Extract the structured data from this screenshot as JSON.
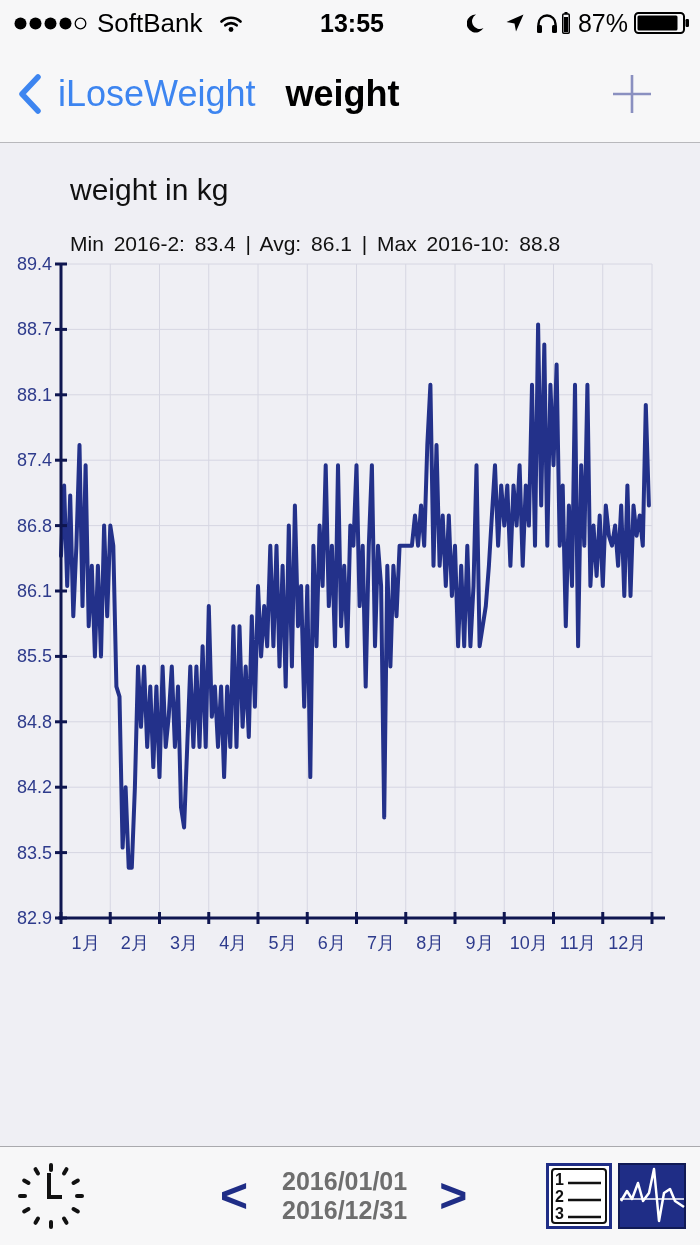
{
  "status_bar": {
    "carrier": "SoftBank",
    "time": "13:55",
    "battery": "87%"
  },
  "nav_bar": {
    "back_label": "iLoseWeight",
    "title": "weight"
  },
  "chart": {
    "summary": "Min 2016-2: 83.4 | Avg: 86.1 | Max 2016-10: 88.8",
    "chart_data": {
      "type": "line",
      "title": "weight in kg",
      "x": [
        0,
        0.0625,
        0.125,
        0.1875,
        0.25,
        0.3125,
        0.375,
        0.4375,
        0.5,
        0.5625,
        0.625,
        0.6875,
        0.75,
        0.8125,
        0.875,
        0.9375,
        1,
        1.0625,
        1.125,
        1.1875,
        1.25,
        1.3125,
        1.375,
        1.4375,
        1.5,
        1.5625,
        1.625,
        1.6875,
        1.75,
        1.8125,
        1.875,
        1.9375,
        2,
        2.0625,
        2.125,
        2.1875,
        2.25,
        2.3125,
        2.375,
        2.4375,
        2.5,
        2.5625,
        2.625,
        2.6875,
        2.75,
        2.8125,
        2.875,
        2.9375,
        3,
        3.0625,
        3.125,
        3.1875,
        3.25,
        3.3125,
        3.375,
        3.4375,
        3.5,
        3.5625,
        3.625,
        3.6875,
        3.75,
        3.8125,
        3.875,
        3.9375,
        4,
        4.0625,
        4.125,
        4.1875,
        4.25,
        4.3125,
        4.375,
        4.4375,
        4.5,
        4.5625,
        4.625,
        4.6875,
        4.75,
        4.8125,
        4.875,
        4.9375,
        5,
        5.0625,
        5.125,
        5.1875,
        5.25,
        5.3125,
        5.375,
        5.4375,
        5.5,
        5.5625,
        5.625,
        5.6875,
        5.75,
        5.8125,
        5.875,
        5.9375,
        6,
        6.0625,
        6.125,
        6.1875,
        6.25,
        6.3125,
        6.375,
        6.4375,
        6.5,
        6.5625,
        6.625,
        6.6875,
        6.75,
        6.8125,
        6.875,
        6.9375,
        7,
        7.0625,
        7.125,
        7.1875,
        7.25,
        7.3125,
        7.375,
        7.4375,
        7.5,
        7.5625,
        7.625,
        7.6875,
        7.75,
        7.8125,
        7.875,
        7.9375,
        8,
        8.0625,
        8.125,
        8.1875,
        8.25,
        8.3125,
        8.375,
        8.4375,
        8.5,
        8.5625,
        8.625,
        8.6875,
        8.75,
        8.8125,
        8.875,
        8.9375,
        9,
        9.0625,
        9.125,
        9.1875,
        9.25,
        9.3125,
        9.375,
        9.4375,
        9.5,
        9.5625,
        9.625,
        9.6875,
        9.75,
        9.8125,
        9.875,
        9.9375,
        10,
        10.0625,
        10.125,
        10.1875,
        10.25,
        10.3125,
        10.375,
        10.4375,
        10.5,
        10.5625,
        10.625,
        10.6875,
        10.75,
        10.8125,
        10.875,
        10.9375,
        11,
        11.0625,
        11.125,
        11.1875,
        11.25,
        11.3125,
        11.375,
        11.4375,
        11.5,
        11.5625,
        11.625,
        11.6875,
        11.75,
        11.8125,
        11.875,
        11.9375
      ],
      "xlim": [
        0,
        12
      ],
      "xticks": [
        {
          "value": 0.5,
          "label": "1月"
        },
        {
          "value": 1.5,
          "label": "2月"
        },
        {
          "value": 2.5,
          "label": "3月"
        },
        {
          "value": 3.5,
          "label": "4月"
        },
        {
          "value": 4.5,
          "label": "5月"
        },
        {
          "value": 5.5,
          "label": "6月"
        },
        {
          "value": 6.5,
          "label": "7月"
        },
        {
          "value": 7.5,
          "label": "8月"
        },
        {
          "value": 8.5,
          "label": "9月"
        },
        {
          "value": 9.5,
          "label": "10月"
        },
        {
          "value": 10.5,
          "label": "11月"
        },
        {
          "value": 11.5,
          "label": "12月"
        }
      ],
      "ylim": [
        82.9,
        89.4
      ],
      "yticks": [
        {
          "value": 82.9,
          "label": "82.9"
        },
        {
          "value": 83.55,
          "label": "83.5"
        },
        {
          "value": 84.2,
          "label": "84.2"
        },
        {
          "value": 84.85,
          "label": "84.8"
        },
        {
          "value": 85.5,
          "label": "85.5"
        },
        {
          "value": 86.15,
          "label": "86.1"
        },
        {
          "value": 86.8,
          "label": "86.8"
        },
        {
          "value": 87.45,
          "label": "87.4"
        },
        {
          "value": 88.1,
          "label": "88.1"
        },
        {
          "value": 88.75,
          "label": "88.7"
        },
        {
          "value": 89.4,
          "label": "89.4"
        }
      ],
      "grid": true,
      "series": [
        {
          "color": "#23318a",
          "values": [
            86.5,
            87.2,
            86.2,
            87.1,
            85.9,
            86.6,
            87.6,
            86.0,
            87.4,
            85.8,
            86.4,
            85.5,
            86.4,
            85.5,
            86.8,
            85.9,
            86.8,
            86.6,
            85.2,
            85.1,
            83.6,
            84.2,
            83.4,
            83.4,
            84.2,
            85.4,
            84.8,
            85.4,
            84.6,
            85.2,
            84.4,
            85.2,
            84.3,
            85.4,
            84.6,
            84.9,
            85.4,
            84.6,
            85.2,
            84.0,
            83.8,
            84.6,
            85.4,
            84.6,
            85.4,
            84.6,
            85.6,
            84.6,
            86.0,
            84.9,
            85.2,
            84.6,
            85.2,
            84.3,
            85.2,
            84.6,
            85.8,
            84.6,
            85.8,
            84.8,
            85.4,
            84.7,
            85.9,
            85.0,
            86.2,
            85.5,
            86.0,
            85.6,
            86.6,
            85.6,
            86.6,
            85.4,
            86.4,
            85.2,
            86.8,
            85.4,
            87.0,
            85.8,
            86.2,
            85.0,
            86.2,
            84.3,
            86.6,
            85.6,
            86.8,
            86.2,
            87.4,
            86.0,
            86.6,
            85.6,
            87.4,
            85.8,
            86.4,
            85.6,
            86.8,
            86.6,
            87.4,
            86.0,
            86.6,
            85.2,
            86.6,
            87.4,
            85.6,
            86.6,
            86.2,
            83.9,
            86.4,
            85.4,
            86.4,
            85.9,
            86.6,
            86.6,
            86.6,
            86.6,
            86.6,
            86.9,
            86.6,
            87.0,
            86.6,
            87.6,
            88.2,
            86.4,
            87.6,
            86.4,
            86.9,
            86.2,
            86.9,
            86.1,
            86.6,
            85.6,
            86.4,
            85.6,
            86.6,
            85.6,
            86.2,
            87.4,
            85.6,
            85.8,
            86.0,
            86.4,
            86.9,
            87.4,
            86.6,
            87.2,
            86.8,
            87.2,
            86.4,
            87.2,
            86.8,
            87.4,
            86.4,
            87.2,
            86.8,
            88.2,
            86.6,
            88.8,
            87.0,
            88.6,
            86.6,
            88.2,
            87.4,
            88.4,
            86.6,
            87.2,
            85.8,
            87.0,
            86.2,
            88.2,
            85.6,
            87.4,
            86.6,
            88.2,
            86.2,
            86.8,
            86.3,
            86.9,
            86.2,
            87.0,
            86.7,
            86.6,
            86.8,
            86.4,
            87.0,
            86.1,
            87.2,
            86.1,
            87.0,
            86.7,
            86.9,
            86.6,
            88.0,
            87.0
          ]
        }
      ]
    }
  },
  "toolbar": {
    "previous": "<",
    "next": ">",
    "date_range": {
      "start": "2016/01/01",
      "end": "2016/12/31"
    },
    "views": [
      {
        "kind": "list",
        "selected": false,
        "numbers": [
          "1",
          "2",
          "3"
        ]
      },
      {
        "kind": "chart",
        "selected": true
      }
    ]
  }
}
